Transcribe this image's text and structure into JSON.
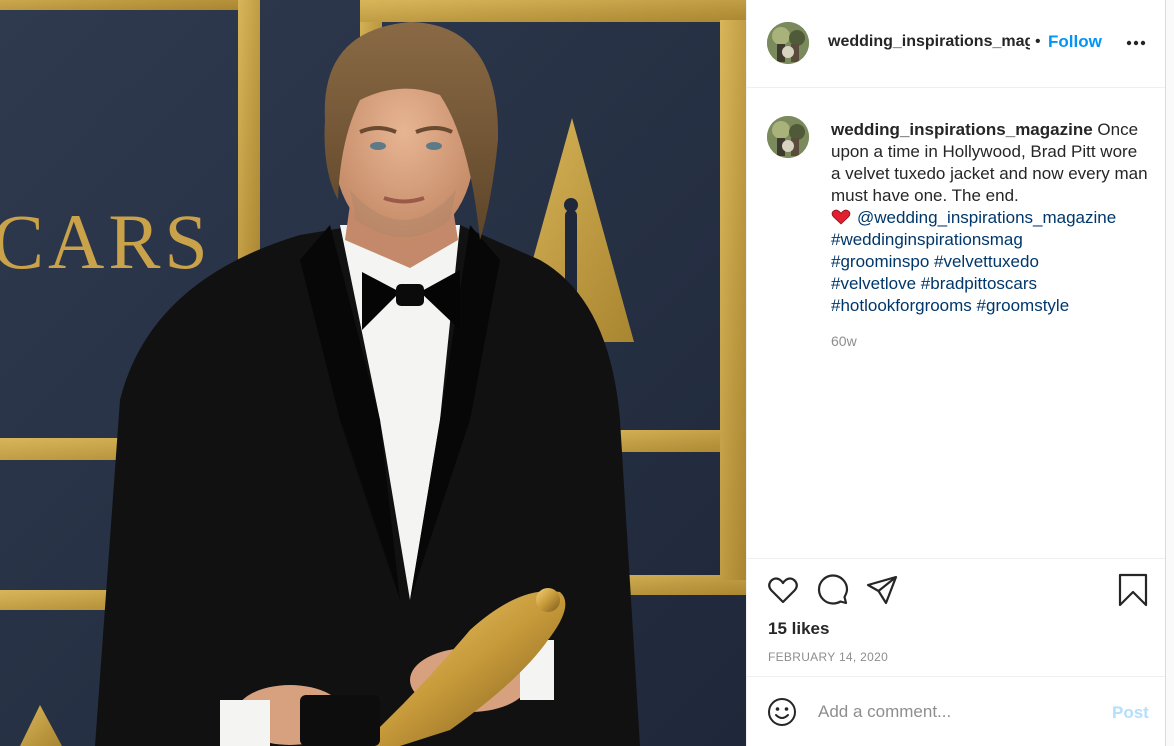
{
  "photo": {
    "backdrop_text": "CARS",
    "colors": {
      "backdrop": "#2a3447",
      "gold": "#c8a24a",
      "suit": "#111111",
      "shirt": "#f4f4f2"
    }
  },
  "header": {
    "username": "wedding_inspirations_mag",
    "separator": "•",
    "follow_label": "Follow",
    "more_icon": "ellipsis-icon"
  },
  "caption": {
    "username": "wedding_inspirations_magazine",
    "body": "Once upon a time in Hollywood, Brad Pitt wore a velvet tuxedo jacket and now every man must have one. The end.",
    "heart_icon": "red-heart-emoji",
    "mention": "@wedding_inspirations_magazine",
    "hashtags": [
      "#weddinginspirationsmag",
      "#groominspo",
      "#velvettuxedo",
      "#velvetlove",
      "#bradpittoscars",
      "#hotlookforgrooms",
      "#groomstyle"
    ],
    "age": "60w"
  },
  "actions": {
    "icons": [
      "heart-icon",
      "comment-icon",
      "share-icon",
      "bookmark-icon"
    ],
    "likes": "15 likes",
    "date": "FEBRUARY 14, 2020"
  },
  "comment": {
    "placeholder": "Add a comment...",
    "post_label": "Post",
    "emoji_icon": "smiley-icon"
  },
  "colors": {
    "accent": "#0095f6",
    "link": "#00376b",
    "muted": "#8e8e8e",
    "post_disabled": "#b2dffc"
  }
}
